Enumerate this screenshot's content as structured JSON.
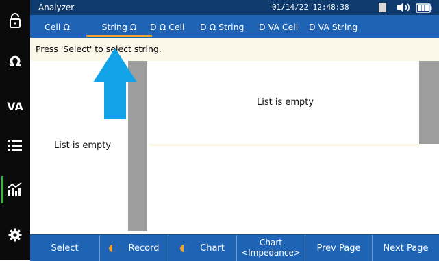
{
  "app": {
    "title": "Analyzer",
    "datetime": "01/14/22  12:48:38"
  },
  "sidebar": {
    "items": [
      {
        "label": "",
        "icon": "lock-icon"
      },
      {
        "label": "Ω",
        "icon": "ohm-icon"
      },
      {
        "label": "VA",
        "icon": "va-icon"
      },
      {
        "label": "",
        "icon": "list-icon"
      },
      {
        "label": "",
        "icon": "chart-icon",
        "active": true
      },
      {
        "label": "",
        "icon": "gear-icon"
      }
    ]
  },
  "tabs": [
    {
      "label": "Cell Ω"
    },
    {
      "label": "String Ω",
      "active": true
    },
    {
      "label": "D Ω Cell"
    },
    {
      "label": "D Ω String"
    },
    {
      "label": "D VA Cell"
    },
    {
      "label": "D VA String"
    }
  ],
  "message": "Press 'Select' to select string.",
  "left_pane": {
    "empty_text": "List is empty"
  },
  "right_pane": {
    "empty_text": "List is empty"
  },
  "footer": {
    "select": "Select",
    "record": "Record",
    "chart": "Chart",
    "chart_impedance_line1": "Chart",
    "chart_impedance_line2": "<Impedance>",
    "prev_page": "Prev Page",
    "next_page": "Next Page"
  },
  "colors": {
    "header": "#1f63b5",
    "titlebar": "#0e3a6e",
    "accent": "#f0a030",
    "arrow": "#12a3e8",
    "active_indicator": "#3fb04a"
  }
}
